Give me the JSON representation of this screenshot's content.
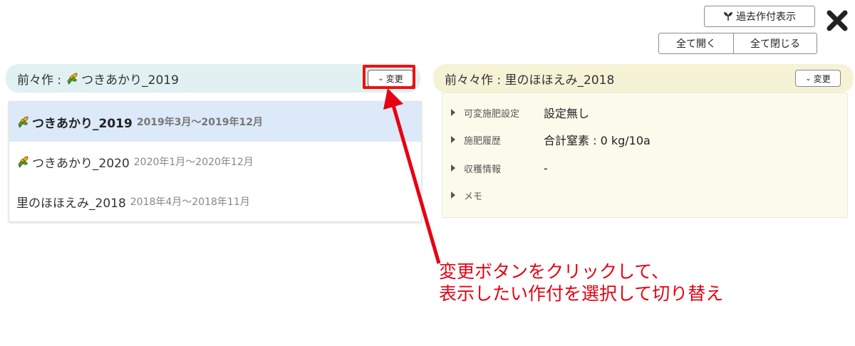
{
  "toolbar": {
    "past_crops_label": "過去作付表示",
    "open_all_label": "全て開く",
    "close_all_label": "全て閉じる"
  },
  "left_panel": {
    "header_prefix": "前々作 : ",
    "header_crop": "つきあかり_2019",
    "change_label": "変更",
    "dropdown_items": [
      {
        "name": "つきあかり_2019",
        "range": "2019年3月～2019年12月",
        "icon": "sprout-icon",
        "selected": true
      },
      {
        "name": "つきあかり_2020",
        "range": "2020年1月～2020年12月",
        "icon": "sprout-icon",
        "selected": false
      },
      {
        "name": "里のほほえみ_2018",
        "range": "2018年4月～2018年11月",
        "icon": "",
        "selected": false
      }
    ]
  },
  "right_panel": {
    "header": "前々々作 : 里のほほえみ_2018",
    "change_label": "変更",
    "rows": [
      {
        "label": "可変施肥設定",
        "value": "設定無し"
      },
      {
        "label": "施肥履歴",
        "value": "合計窒素 : 0 kg/10a"
      },
      {
        "label": "収穫情報",
        "value": "-"
      },
      {
        "label": "メモ",
        "value": ""
      }
    ]
  },
  "annotation": {
    "line1": "変更ボタンをクリックして、",
    "line2": "表示したい作付を選択して切り替え",
    "color": "#e60012"
  },
  "colors": {
    "left_header_bg": "#e1f1f1",
    "right_header_bg": "#f5f2d6",
    "selected_bg": "#dce9f9"
  }
}
